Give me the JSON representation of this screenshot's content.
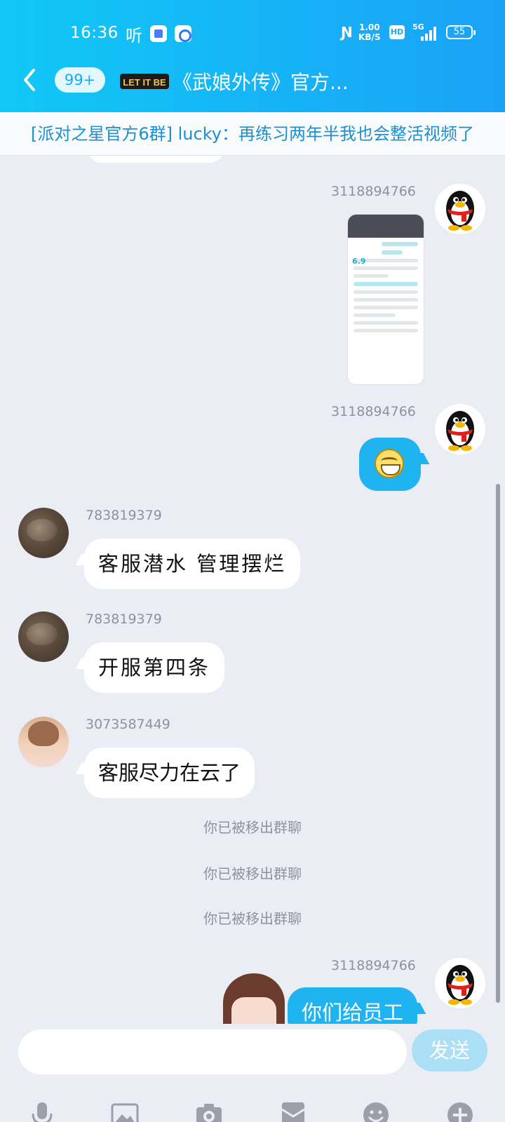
{
  "status_bar": {
    "time": "16:36",
    "ting": "听",
    "speed_value": "1.00",
    "speed_unit": "KB/S",
    "hd": "HD",
    "network": "5G",
    "battery": "55"
  },
  "nav": {
    "unread_count": "99+",
    "logo_text": "LET IT BE",
    "title": "《武娘外传》官方..."
  },
  "banner": {
    "text": "[派对之星官方6群] lucky：再练习两年半我也会整活视频了"
  },
  "messages": [
    {
      "sender": "3118894766",
      "type": "image",
      "side": "right",
      "image_score": "6.9"
    },
    {
      "sender": "3118894766",
      "type": "emoji",
      "side": "right",
      "emoji": "grinning-face"
    },
    {
      "sender": "783819379",
      "type": "text",
      "side": "left",
      "text": "客服潜水 管理摆烂"
    },
    {
      "sender": "783819379",
      "type": "text",
      "side": "left",
      "text": "开服第四条"
    },
    {
      "sender": "3073587449",
      "type": "text",
      "side": "left",
      "text": "客服尽力在云了"
    },
    {
      "sender": "3118894766",
      "type": "text",
      "side": "right",
      "text": "你们给员工"
    }
  ],
  "system_messages": [
    "你已被移出群聊",
    "你已被移出群聊",
    "你已被移出群聊"
  ],
  "input": {
    "send_label": "发送",
    "placeholder": ""
  },
  "toolbar": [
    "microphone-icon",
    "image-icon",
    "camera-icon",
    "red-packet-icon",
    "emoji-icon",
    "plus-icon"
  ],
  "colors": {
    "header_start": "#11c8f6",
    "header_end": "#1aa2f7",
    "chat_background": "#eaedf4",
    "self_bubble": "#1fb3f2",
    "banner_text": "#1c8fd3",
    "send_button": "#aadff5"
  }
}
